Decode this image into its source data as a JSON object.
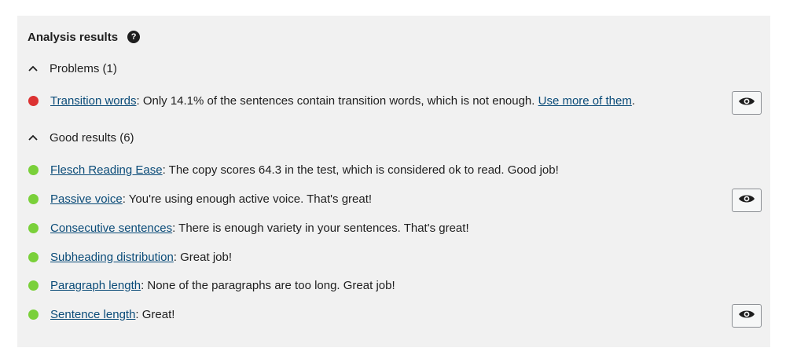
{
  "panel": {
    "title": "Analysis results",
    "help_icon": "question-mark-icon"
  },
  "colors": {
    "panel_bg": "#f1f1f1",
    "problem_bullet": "#dc3232",
    "good_bullet": "#7ad03a",
    "link": "#0a4b78"
  },
  "problems": {
    "header": "Problems (1)",
    "icon": "chevron-up-icon",
    "items": [
      {
        "link": "Transition words",
        "text": ": Only 14.1% of the sentences contain transition words, which is not enough. ",
        "link2": "Use more of them",
        "text2": ".",
        "has_eye": true
      }
    ]
  },
  "good": {
    "header": "Good results (6)",
    "icon": "chevron-up-icon",
    "items": [
      {
        "link": "Flesch Reading Ease",
        "text": ": The copy scores 64.3 in the test, which is considered ok to read. Good job!",
        "has_eye": false
      },
      {
        "link": "Passive voice",
        "text": ": You're using enough active voice. That's great!",
        "has_eye": true
      },
      {
        "link": "Consecutive sentences",
        "text": ": There is enough variety in your sentences. That's great!",
        "has_eye": false
      },
      {
        "link": "Subheading distribution",
        "text": ": Great job!",
        "has_eye": false
      },
      {
        "link": "Paragraph length",
        "text": ": None of the paragraphs are too long. Great job!",
        "has_eye": false
      },
      {
        "link": "Sentence length",
        "text": ": Great!",
        "has_eye": true
      }
    ]
  },
  "eye_icon": "eye-icon"
}
